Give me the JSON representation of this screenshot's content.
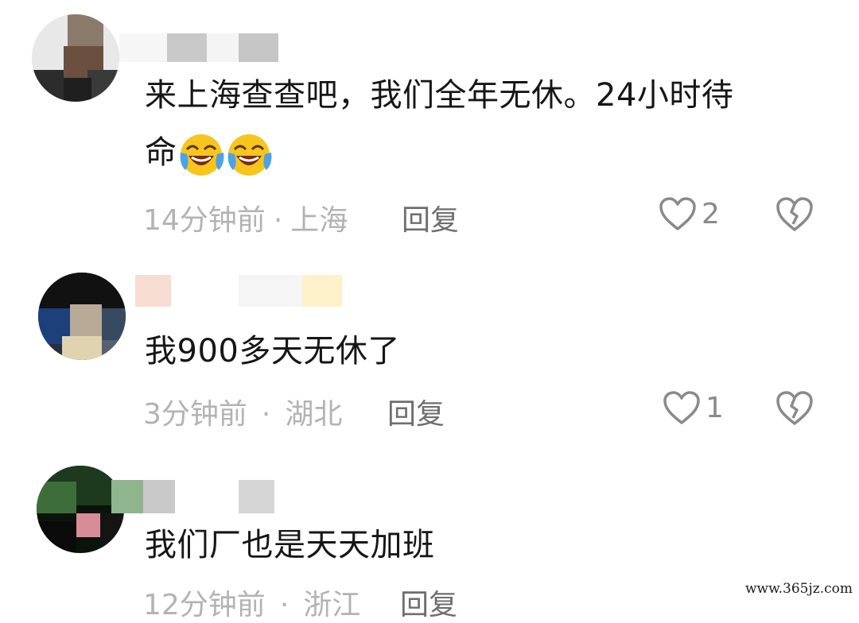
{
  "comments": [
    {
      "text_line1": "来上海查查吧，我们全年无休。24小时待",
      "text_line2": "命",
      "emoji": "laughing-crying-emoji",
      "time": "14分钟前",
      "location": "上海",
      "dot": "·",
      "reply_label": "回复",
      "like_count": "2"
    },
    {
      "text_line1": "我900多天无休了",
      "time": "3分钟前",
      "location": "湖北",
      "dot": "·",
      "reply_label": "回复",
      "like_count": "1"
    },
    {
      "text_line1": "我们厂也是天天加班",
      "time": "12分钟前",
      "location": "浙江",
      "dot": "·",
      "reply_label": "回复"
    }
  ],
  "icons": {
    "like": "heart-outline-icon",
    "dislike": "broken-heart-icon"
  },
  "colors": {
    "text": "#161616",
    "meta": "#b3b3b3",
    "reply": "#6e6e6e",
    "icon": "#8a8a8a"
  },
  "watermark": "www.365jz.com"
}
